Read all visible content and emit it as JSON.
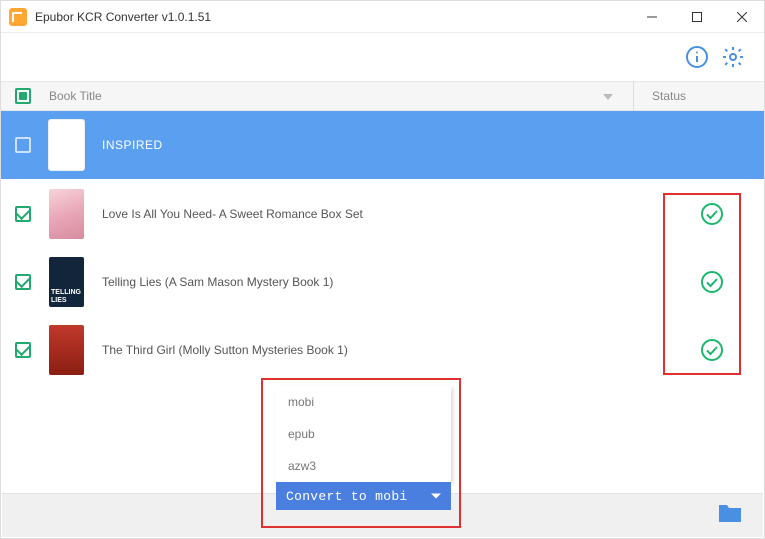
{
  "window": {
    "title": "Epubor KCR Converter v1.0.1.51"
  },
  "columns": {
    "title_label": "Book Title",
    "status_label": "Status"
  },
  "books": [
    {
      "title": "INSPIRED",
      "checked": false,
      "selected": true,
      "thumb": "inspired",
      "status": "none"
    },
    {
      "title": "Love Is All You Need- A Sweet Romance Box Set",
      "checked": true,
      "selected": false,
      "thumb": "romance",
      "status": "ok"
    },
    {
      "title": "Telling Lies (A Sam Mason Mystery Book 1)",
      "checked": true,
      "selected": false,
      "thumb": "lies",
      "status": "ok"
    },
    {
      "title": "The Third Girl (Molly Sutton Mysteries Book 1)",
      "checked": true,
      "selected": false,
      "thumb": "thirdgirl",
      "status": "ok"
    }
  ],
  "dropdown": {
    "options": [
      "mobi",
      "epub",
      "azw3"
    ],
    "button_label": "Convert to mobi"
  }
}
